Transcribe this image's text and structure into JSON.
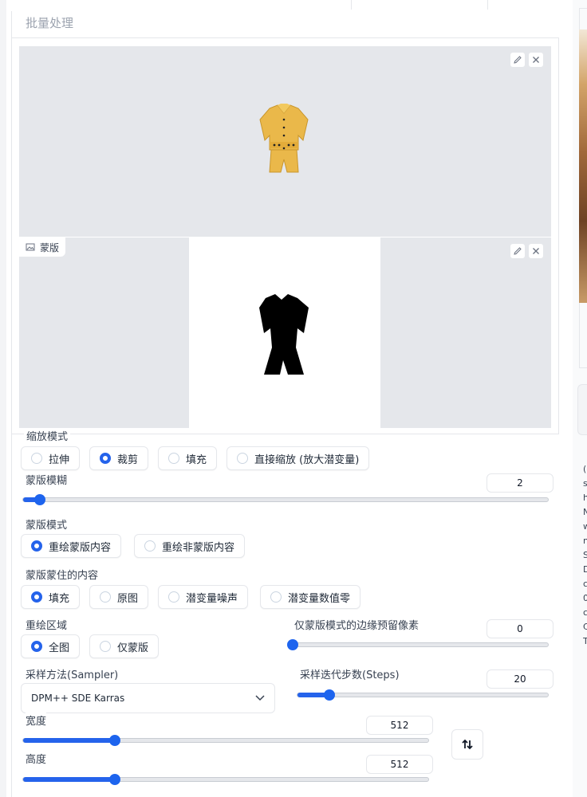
{
  "section_title": "批量处理",
  "mask_label": "蒙版",
  "resize_mode": {
    "label": "缩放模式",
    "options": [
      "拉伸",
      "裁剪",
      "填充",
      "直接缩放 (放大潜变量)"
    ],
    "selected": "裁剪"
  },
  "mask_blur": {
    "label": "蒙版模糊",
    "value": "2",
    "min": 0,
    "max": 64
  },
  "mask_mode": {
    "label": "蒙版模式",
    "options": [
      "重绘蒙版内容",
      "重绘非蒙版内容"
    ],
    "selected": "重绘蒙版内容"
  },
  "masked_content": {
    "label": "蒙版蒙住的内容",
    "options": [
      "填充",
      "原图",
      "潜变量噪声",
      "潜变量数值零"
    ],
    "selected": "填充"
  },
  "inpaint_area": {
    "label": "重绘区域",
    "options": [
      "全图",
      "仅蒙版"
    ],
    "selected": "全图"
  },
  "only_masked_padding": {
    "label": "仅蒙版模式的边缘预留像素",
    "value": "0",
    "min": 0,
    "max": 256
  },
  "sampler": {
    "label": "采样方法(Sampler)",
    "value": "DPM++ SDE Karras"
  },
  "steps": {
    "label": "采样迭代步数(Steps)",
    "value": "20",
    "min": 1,
    "max": 150
  },
  "width": {
    "label": "宽度",
    "value": "512",
    "min": 64,
    "max": 2048
  },
  "height": {
    "label": "高度",
    "value": "512",
    "min": 64,
    "max": 2048
  },
  "right_panel_text": [
    "(",
    "s",
    "h",
    "N",
    "w",
    "n",
    "S",
    "D",
    "c",
    "0",
    "c",
    "C",
    "T"
  ],
  "accent_color": "#2563eb"
}
